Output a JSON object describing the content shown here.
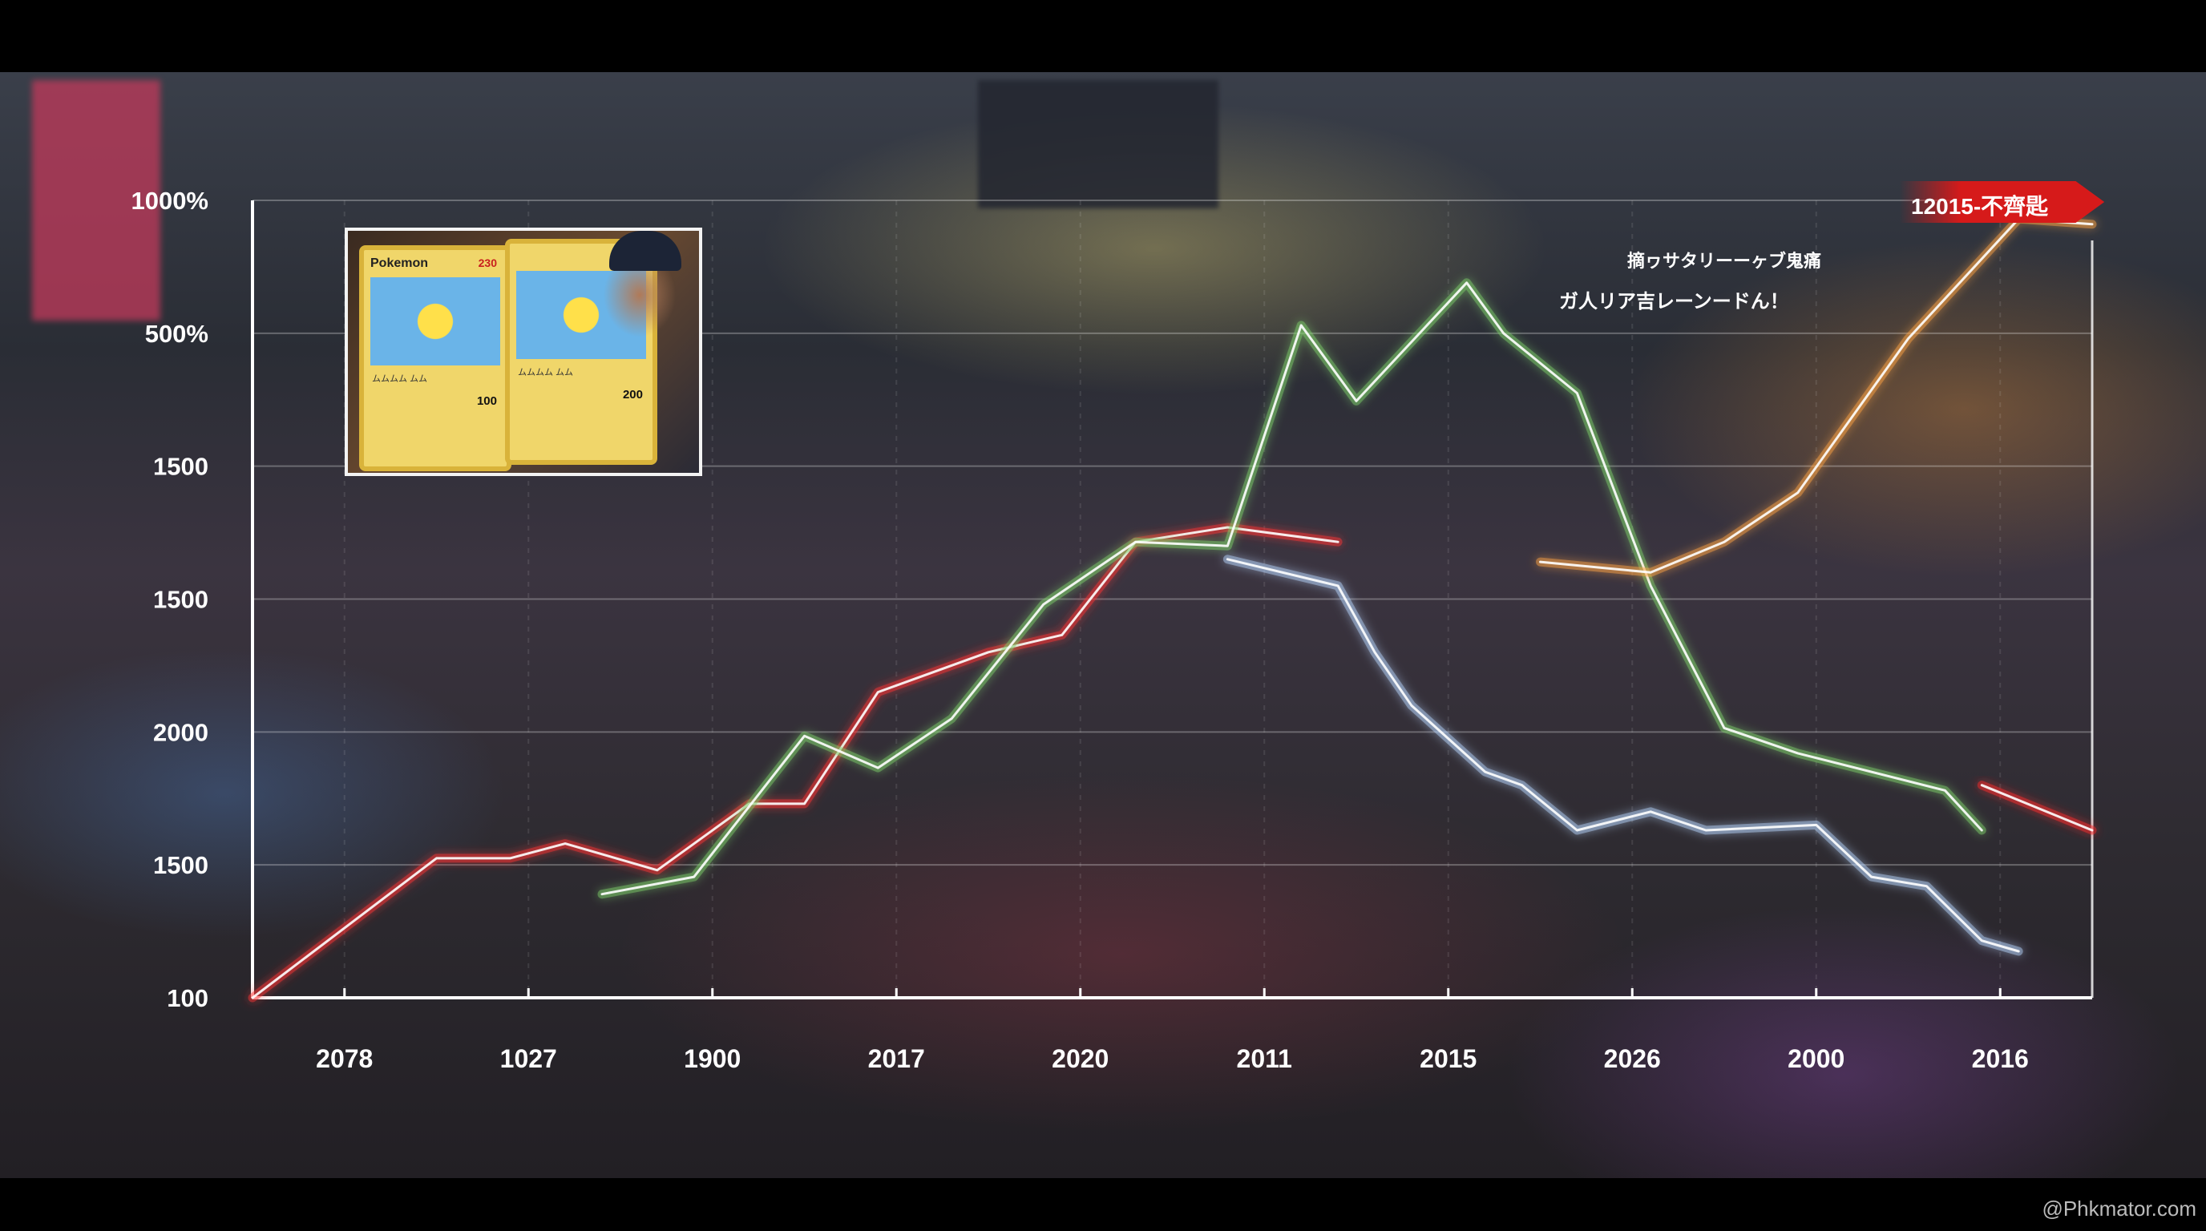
{
  "chart_data": {
    "type": "line",
    "title": "",
    "xlabel": "",
    "ylabel": "",
    "y_tick_labels": [
      "100",
      "1500",
      "2000",
      "1500",
      "1500",
      "500%",
      "1000%"
    ],
    "x_tick_labels": [
      "2078",
      "1027",
      "1900",
      "2017",
      "2020",
      "2011",
      "2015",
      "2026",
      "2000",
      "2016"
    ],
    "ylim": [
      0,
      6
    ],
    "xlim": [
      0,
      10
    ],
    "grid": true,
    "series": [
      {
        "color": "#ff3535",
        "points": [
          [
            0.0,
            0.0
          ],
          [
            1.0,
            1.05
          ],
          [
            1.4,
            1.05
          ],
          [
            1.7,
            1.16
          ],
          [
            2.2,
            0.96
          ],
          [
            2.7,
            1.46
          ],
          [
            3.0,
            1.46
          ],
          [
            3.4,
            2.3
          ],
          [
            4.0,
            2.6
          ],
          [
            4.4,
            2.73
          ],
          [
            4.8,
            3.43
          ],
          [
            5.3,
            3.54
          ],
          [
            5.9,
            3.43
          ]
        ]
      },
      {
        "color": "#7fd06a",
        "points": [
          [
            1.9,
            0.78
          ],
          [
            2.4,
            0.91
          ],
          [
            3.0,
            1.97
          ],
          [
            3.4,
            1.73
          ],
          [
            3.8,
            2.1
          ],
          [
            4.3,
            2.96
          ],
          [
            4.8,
            3.43
          ],
          [
            5.3,
            3.4
          ],
          [
            5.7,
            5.06
          ],
          [
            6.0,
            4.49
          ],
          [
            6.6,
            5.38
          ],
          [
            6.8,
            5.0
          ],
          [
            7.2,
            4.55
          ],
          [
            7.6,
            3.1
          ],
          [
            8.0,
            2.03
          ],
          [
            8.4,
            1.84
          ],
          [
            9.2,
            1.56
          ],
          [
            9.4,
            1.26
          ]
        ]
      },
      {
        "color": "#b8d8ff",
        "points": [
          [
            5.3,
            3.3
          ],
          [
            5.9,
            3.1
          ],
          [
            6.1,
            2.6
          ],
          [
            6.3,
            2.2
          ],
          [
            6.5,
            1.95
          ],
          [
            6.7,
            1.7
          ],
          [
            6.9,
            1.6
          ],
          [
            7.2,
            1.26
          ],
          [
            7.6,
            1.4
          ],
          [
            7.9,
            1.26
          ],
          [
            8.5,
            1.3
          ],
          [
            8.8,
            0.91
          ],
          [
            9.1,
            0.84
          ],
          [
            9.4,
            0.43
          ],
          [
            9.6,
            0.35
          ]
        ]
      },
      {
        "color": "#ffa545",
        "points": [
          [
            7.0,
            3.28
          ],
          [
            7.6,
            3.2
          ],
          [
            8.0,
            3.43
          ],
          [
            8.4,
            3.8
          ],
          [
            9.0,
            4.96
          ],
          [
            9.6,
            5.86
          ],
          [
            10.0,
            5.82
          ]
        ]
      },
      {
        "color": "#ff2a2a",
        "points": [
          [
            9.4,
            1.6
          ],
          [
            10.0,
            1.26
          ]
        ]
      }
    ]
  },
  "inset": {
    "card1": {
      "name": "Pokemon",
      "hp": "230",
      "text": "ムムムム ムム",
      "damage": "100"
    },
    "card2": {
      "hp": "",
      "text": "ムムムム ムム",
      "damage": "200"
    }
  },
  "annotations": {
    "bubble1": "摘ヮサタリーーヶブ鬼痛",
    "bubble2": "ガ人リア吉レーンードん！",
    "arrow_badge": "12015-不齊匙"
  },
  "watermark": "@Phkmator.com",
  "colors": {
    "axis": "#ffffff",
    "arrow_badge": "#d61a1a"
  }
}
